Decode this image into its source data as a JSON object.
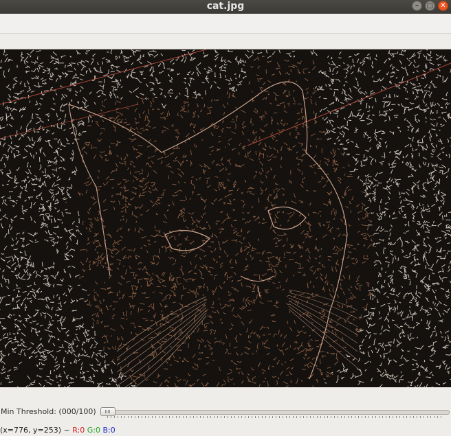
{
  "window": {
    "title": "cat.jpg",
    "buttons": {
      "minimize": "–",
      "maximize": "□",
      "close": "✕"
    }
  },
  "trackbar": {
    "label": "Min Threshold: (000/100)",
    "value": 0,
    "max": 100
  },
  "status": {
    "coords": "(x=776, y=253) ~",
    "r": "R:0",
    "g": "G:0",
    "b": "B:0"
  },
  "image": {
    "icon": "canny-edge-cat-image",
    "background_color": "#14110e",
    "edge_color_light": "#e6dbcf",
    "edge_color_cat": "#8a5e44",
    "edge_color_red_line": "#b0493a"
  }
}
